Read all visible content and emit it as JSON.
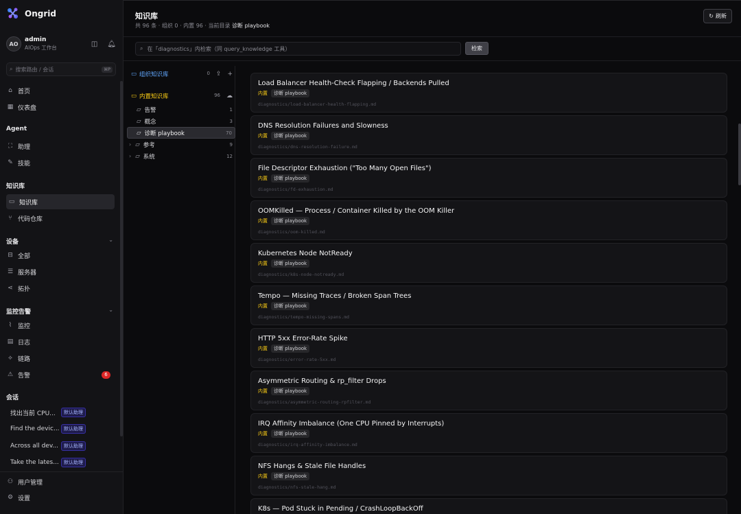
{
  "app": {
    "name": "Ongrid"
  },
  "user": {
    "initials": "AO",
    "name": "admin",
    "subtitle": "AIOps 工作台"
  },
  "sidebar": {
    "search_placeholder": "搜索路由 / 会话",
    "search_kbd": "⌘P",
    "home": "首页",
    "dashboard": "仪表盘",
    "agent_title": "Agent",
    "assistant": "助理",
    "skills": "技能",
    "kb_title": "知识库",
    "kb": "知识库",
    "repos": "代码仓库",
    "devices_title": "设备",
    "all": "全部",
    "servers": "服务器",
    "topology": "拓扑",
    "monitor_title": "监控告警",
    "monitor": "监控",
    "logs": "日志",
    "traces": "链路",
    "alerts": "告警",
    "alerts_count": "6",
    "conv_title": "会话",
    "conversations": [
      {
        "text": "找出当前 CPU...",
        "tag": "默认助理"
      },
      {
        "text": "Find the devic...",
        "tag": "默认助理"
      },
      {
        "text": "Across all dev...",
        "tag": "默认助理"
      },
      {
        "text": "Take the lates...",
        "tag": "默认助理"
      }
    ],
    "user_mgmt": "用户管理",
    "settings": "设置"
  },
  "header": {
    "title": "知识库",
    "subtitle_prefix": "共 96 条 · 组织 0 · 内置 96 · 当前目录",
    "current_dir": "诊断 playbook",
    "refresh": "刷新"
  },
  "search": {
    "placeholder": "在「diagnostics」内检索（同 query_knowledge 工具）",
    "button": "检索"
  },
  "tree": {
    "org_label": "组织知识库",
    "org_count": "0",
    "builtin_label": "内置知识库",
    "builtin_count": "96",
    "folders": [
      {
        "label": "告警",
        "count": "1"
      },
      {
        "label": "概念",
        "count": "3"
      },
      {
        "label": "诊断 playbook",
        "count": "70"
      },
      {
        "label": "参考",
        "count": "9"
      },
      {
        "label": "系统",
        "count": "12"
      }
    ]
  },
  "cards": [
    {
      "title": "Load Balancer Health-Check Flapping / Backends Pulled",
      "builtin": "内置",
      "category": "诊断 playbook",
      "path": "diagnostics/load-balancer-health-flapping.md"
    },
    {
      "title": "DNS Resolution Failures and Slowness",
      "builtin": "内置",
      "category": "诊断 playbook",
      "path": "diagnostics/dns-resolution-failure.md"
    },
    {
      "title": "File Descriptor Exhaustion (\"Too Many Open Files\")",
      "builtin": "内置",
      "category": "诊断 playbook",
      "path": "diagnostics/fd-exhaustion.md"
    },
    {
      "title": "OOMKilled — Process / Container Killed by the OOM Killer",
      "builtin": "内置",
      "category": "诊断 playbook",
      "path": "diagnostics/oom-killed.md"
    },
    {
      "title": "Kubernetes Node NotReady",
      "builtin": "内置",
      "category": "诊断 playbook",
      "path": "diagnostics/k8s-node-notready.md"
    },
    {
      "title": "Tempo — Missing Traces / Broken Span Trees",
      "builtin": "内置",
      "category": "诊断 playbook",
      "path": "diagnostics/tempo-missing-spans.md"
    },
    {
      "title": "HTTP 5xx Error-Rate Spike",
      "builtin": "内置",
      "category": "诊断 playbook",
      "path": "diagnostics/error-rate-5xx.md"
    },
    {
      "title": "Asymmetric Routing & rp_filter Drops",
      "builtin": "内置",
      "category": "诊断 playbook",
      "path": "diagnostics/asymmetric-routing-rpfilter.md"
    },
    {
      "title": "IRQ Affinity Imbalance (One CPU Pinned by Interrupts)",
      "builtin": "内置",
      "category": "诊断 playbook",
      "path": "diagnostics/irq-affinity-imbalance.md"
    },
    {
      "title": "NFS Hangs & Stale File Handles",
      "builtin": "内置",
      "category": "诊断 playbook",
      "path": "diagnostics/nfs-stale-hang.md"
    },
    {
      "title": "K8s — Pod Stuck in Pending / CrashLoopBackOff",
      "builtin": "",
      "category": "",
      "path": ""
    }
  ]
}
